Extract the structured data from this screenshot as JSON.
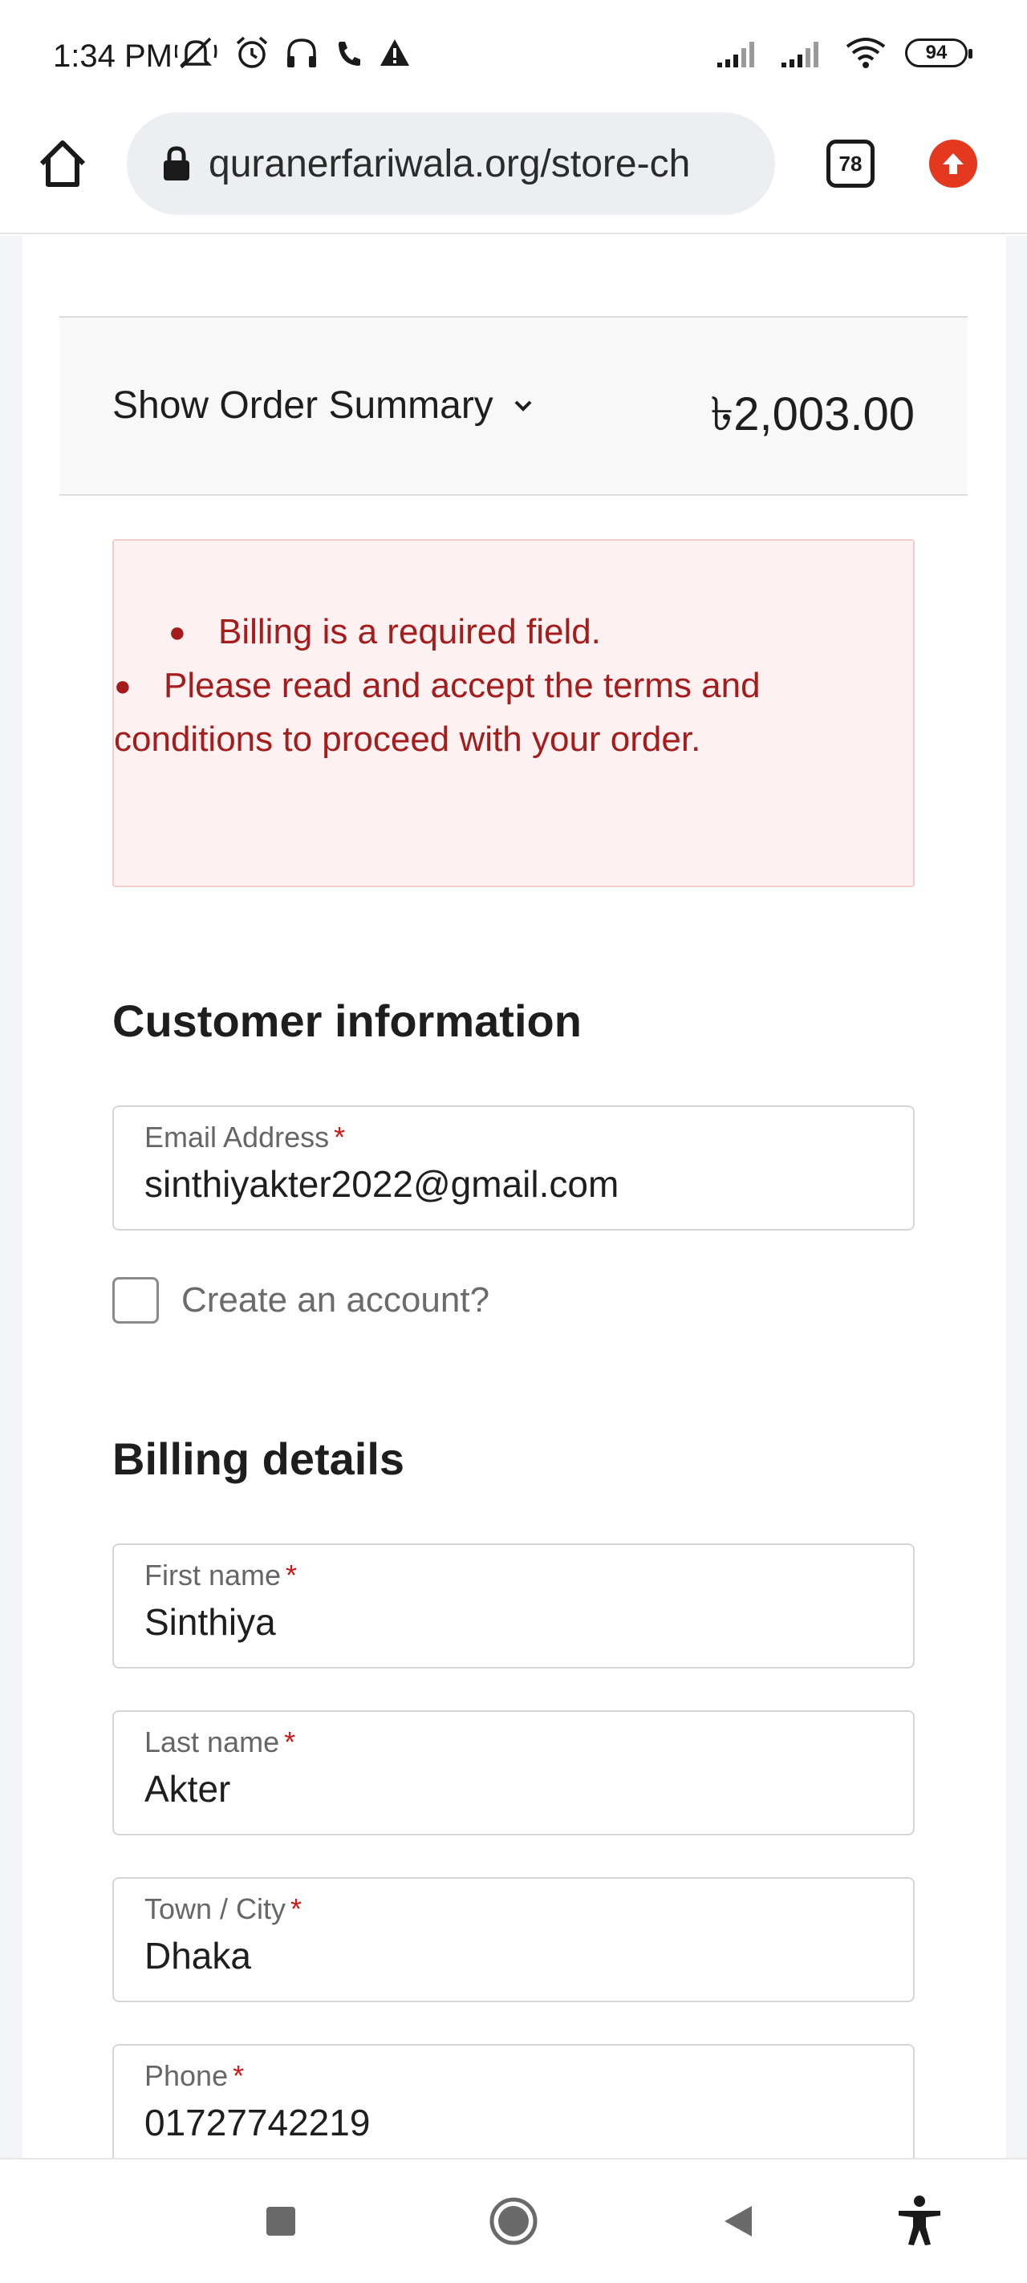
{
  "status_bar": {
    "time": "1:34 PM",
    "battery": "94",
    "icons": [
      "muted-notifications-icon",
      "alarm-icon",
      "headphones-icon",
      "call-icon",
      "warning-icon",
      "signal-icon",
      "signal-icon",
      "wifi-icon",
      "battery-icon"
    ]
  },
  "browser": {
    "url": "quranerfariwala.org/store-ch",
    "tab_count": "78",
    "icons": [
      "home-icon",
      "lock-icon",
      "tabs-icon",
      "update-icon"
    ]
  },
  "order_summary": {
    "toggle_label": "Show Order Summary",
    "total": "৳2,003.00"
  },
  "errors": {
    "items": [
      "Billing is a required field.",
      "Please read and accept the terms and conditions to proceed with your order."
    ],
    "color": "#a51c1c"
  },
  "customer_information": {
    "heading": "Customer information",
    "email": {
      "label": "Email Address",
      "required_mark": "*",
      "value": "sinthiyakter2022@gmail.com"
    },
    "create_account_label": "Create an account?",
    "create_account_checked": false
  },
  "billing_details": {
    "heading": "Billing details",
    "first_name": {
      "label": "First name",
      "required_mark": "*",
      "value": "Sinthiya"
    },
    "last_name": {
      "label": "Last name",
      "required_mark": "*",
      "value": "Akter"
    },
    "town_city": {
      "label": "Town / City",
      "required_mark": "*",
      "value": "Dhaka"
    },
    "phone": {
      "label": "Phone",
      "required_mark": "*",
      "value": "01727742219"
    }
  },
  "nav_bar": {
    "icons": [
      "recent-apps-icon",
      "home-circle-icon",
      "back-icon",
      "accessibility-icon"
    ]
  }
}
